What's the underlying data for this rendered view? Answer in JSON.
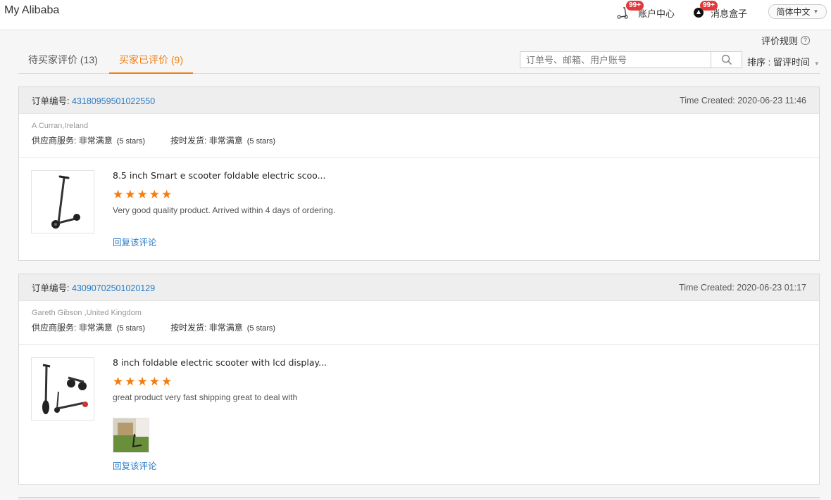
{
  "header": {
    "brand": "My Alibaba",
    "account_center": {
      "label": "账户中心",
      "badge": "99+"
    },
    "message_box": {
      "label": "消息盒子",
      "badge": "99+"
    },
    "language": "简体中文"
  },
  "rule_link": "评价规则",
  "tabs": [
    {
      "label": "待买家评价 (13)",
      "active": false
    },
    {
      "label": "买家已评价 (9)",
      "active": true
    }
  ],
  "search": {
    "placeholder": "订单号、邮箱、用户账号"
  },
  "sort": {
    "label": "排序 : 留评时间"
  },
  "colors": {
    "accent": "#f57d0f",
    "link": "#2a7cc7"
  },
  "reviews": [
    {
      "order_label": "订单编号:",
      "order_no": "43180959501022550",
      "time_created": "Time Created: 2020-06-23 11:46",
      "buyer": "A Curran,Ireland",
      "service_label": "供应商服务:",
      "service_value": "非常满意",
      "service_stars": "(5 stars)",
      "shipping_label": "按时发货:",
      "shipping_value": "非常满意",
      "shipping_stars": "(5 stars)",
      "product_title": "8.5 inch Smart e scooter foldable electric scoo...",
      "rating": 5,
      "comment": "Very good quality product. Arrived within 4 days of ordering.",
      "reply_label": "回复该评论"
    },
    {
      "order_label": "订单编号:",
      "order_no": "43090702501020129",
      "time_created": "Time Created: 2020-06-23 01:17",
      "buyer": "Gareth Gibson ,United Kingdom",
      "service_label": "供应商服务:",
      "service_value": "非常满意",
      "service_stars": "(5 stars)",
      "shipping_label": "按时发货:",
      "shipping_value": "非常满意",
      "shipping_stars": "(5 stars)",
      "product_title": "8 inch foldable electric scooter with lcd display...",
      "rating": 5,
      "comment": "great product very fast shipping great to deal with",
      "reply_label": "回复该评论"
    }
  ]
}
